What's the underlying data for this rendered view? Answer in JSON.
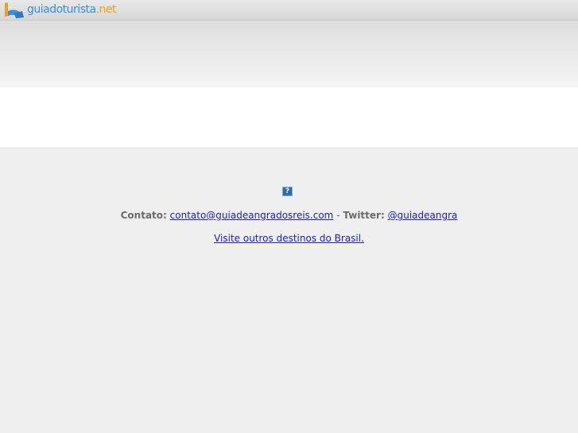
{
  "brand": {
    "name_base": "guiadoturista",
    "name_tld": ".net",
    "colors": {
      "blue": "#3a8fd8",
      "orange": "#f0a11c"
    }
  },
  "help_icon": {
    "glyph": "?"
  },
  "footer": {
    "contact_label": "Contato:",
    "contact_email": "contato@guiadeangradosreis.com",
    "separator": " - ",
    "twitter_label": "Twitter:",
    "twitter_handle": "@guiadeangra",
    "destinations_link": "Visite outros destinos do Brasil."
  },
  "colors": {
    "link": "#1a1ad8",
    "page_bg": "#efefef",
    "label_text": "#6b6b6b"
  }
}
